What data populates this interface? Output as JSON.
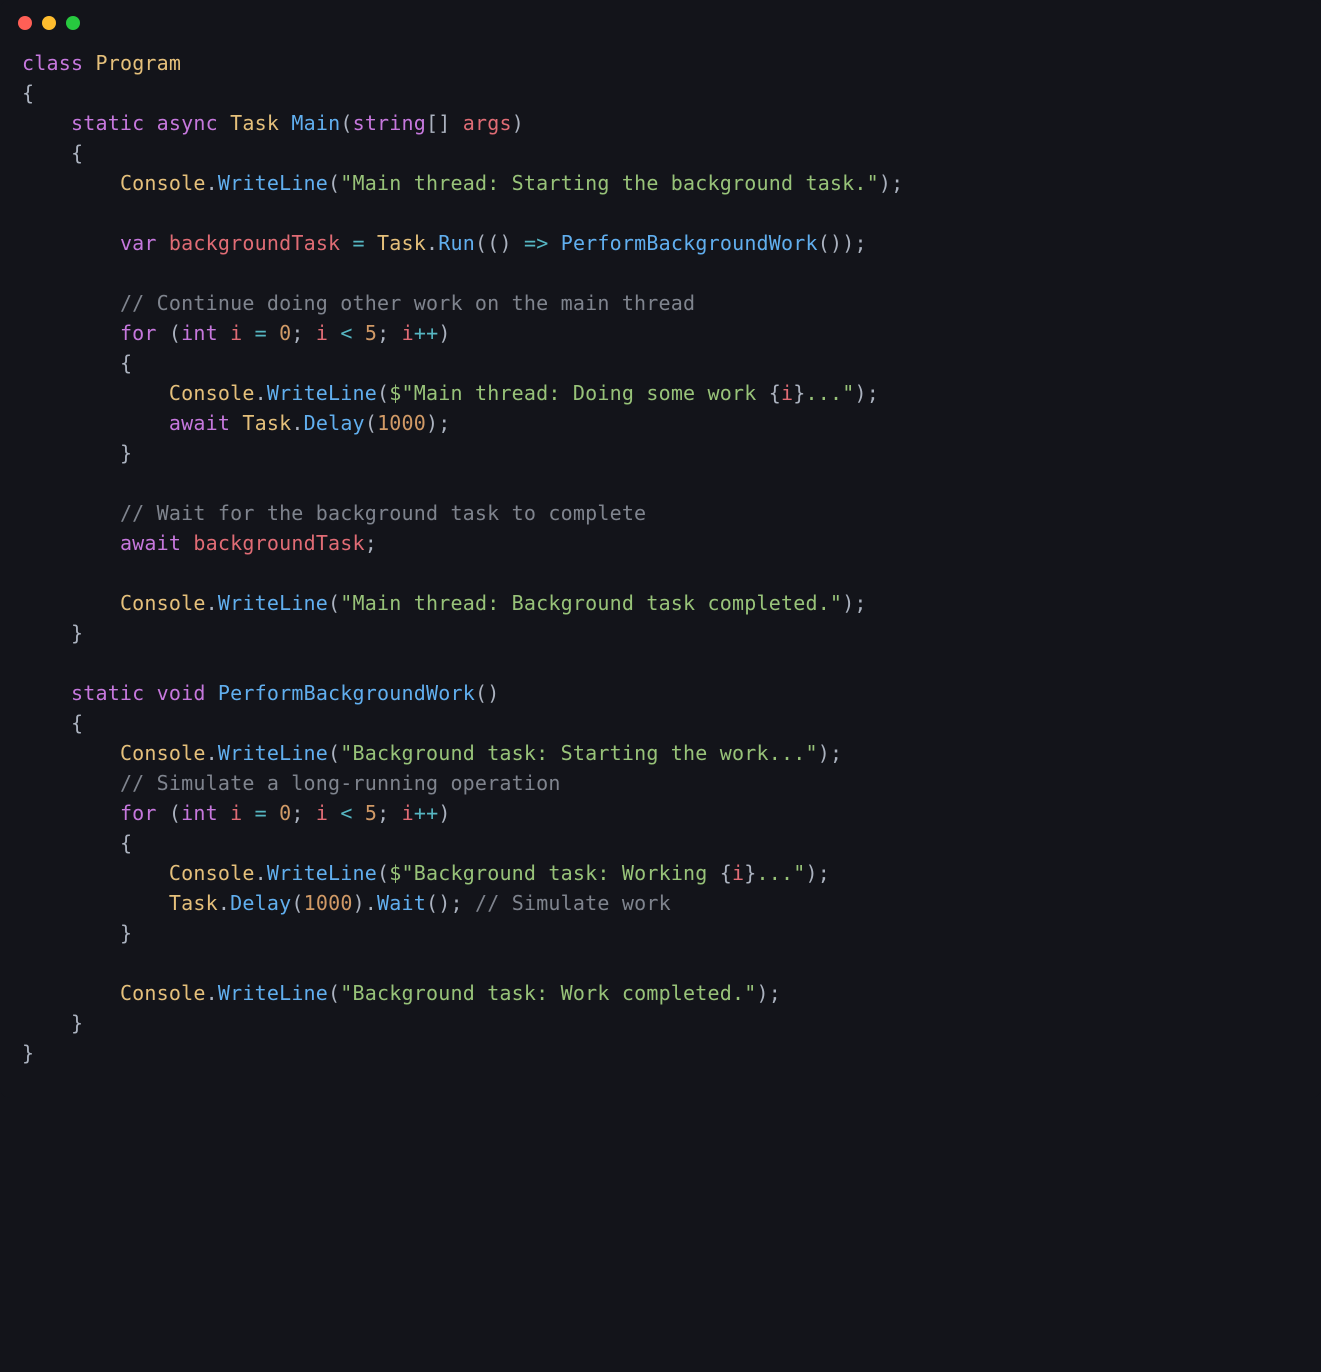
{
  "colors": {
    "background": "#13141a",
    "traffic_red": "#ff5f56",
    "traffic_yellow": "#ffbd2e",
    "traffic_green": "#27c93f",
    "keyword": "#c678dd",
    "type": "#e5c07b",
    "method": "#61afef",
    "method_alt": "#56b6c2",
    "variable": "#e06c75",
    "string": "#98c379",
    "number": "#d19a66",
    "comment": "#7f848e",
    "punctuation": "#abb2bf",
    "operator": "#56b6c2"
  },
  "tokens": {
    "class_kw": "class",
    "static_kw": "static",
    "async_kw": "async",
    "void_kw": "void",
    "var_kw": "var",
    "for_kw": "for",
    "int_kw": "int",
    "await_kw": "await",
    "string_kw": "string",
    "Program": "Program",
    "Task": "Task",
    "Console": "Console",
    "Main": "Main",
    "WriteLine": "WriteLine",
    "Run": "Run",
    "Delay": "Delay",
    "Wait": "Wait",
    "PerformBackgroundWork": "PerformBackgroundWork",
    "args": "args",
    "backgroundTask": "backgroundTask",
    "i": "i",
    "zero": "0",
    "five": "5",
    "thousand": "1000",
    "arrow": "=>",
    "plusplus": "++",
    "lt": "<",
    "eq": "=",
    "openInterp": "{",
    "closeInterp": "}",
    "str_start_bg": "\"Main thread: Starting the background task.\"",
    "str_doing_work_a": "\"Main thread: Doing some work ",
    "str_doing_work_b": "...\"",
    "str_bg_completed": "\"Main thread: Background task completed.\"",
    "str_bg_starting": "\"Background task: Starting the work...\"",
    "str_bg_working_a": "\"Background task: Working ",
    "str_bg_working_b": "...\"",
    "str_bg_work_done": "\"Background task: Work completed.\"",
    "cmt_continue": "// Continue doing other work on the main thread",
    "cmt_wait": "// Wait for the background task to complete",
    "cmt_simulate_long": "// Simulate a long-running operation",
    "cmt_simulate_work": "// Simulate work",
    "dollar": "$"
  }
}
